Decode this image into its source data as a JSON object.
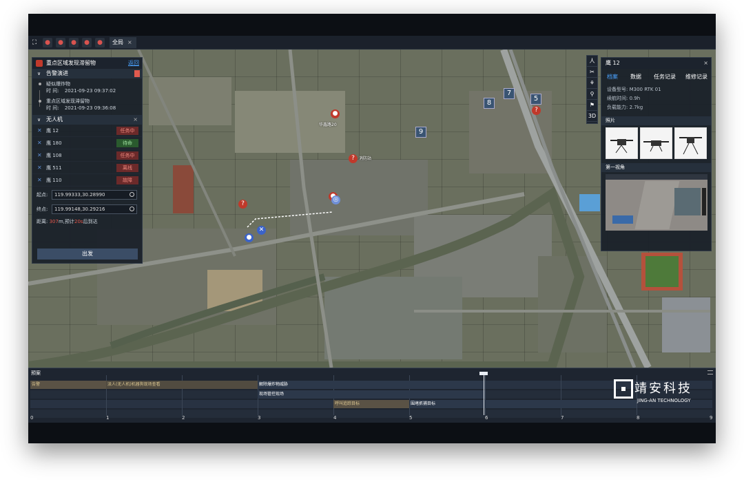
{
  "tab": {
    "label": "全局",
    "close": "×"
  },
  "left_panel": {
    "title": "重点区域发现滞留物",
    "back": "返回",
    "alert_section": "告警演进",
    "alerts": [
      {
        "name": "疑似爆炸物",
        "time_label": "时  间:",
        "time": "2021-09-23 09:37:02"
      },
      {
        "name": "重点区域发现滞留物",
        "time_label": "时  间:",
        "time": "2021-09-23 09:36:08"
      }
    ],
    "uav_section": "无人机",
    "uav_close": "×",
    "uavs": [
      {
        "name": "鹰 12",
        "status": "任务中",
        "tone": "red"
      },
      {
        "name": "鹰 180",
        "status": "待命",
        "tone": "green"
      },
      {
        "name": "鹰 108",
        "status": "任务中",
        "tone": "red"
      },
      {
        "name": "鹰 511",
        "status": "离线",
        "tone": "red"
      },
      {
        "name": "鹰 110",
        "status": "故障",
        "tone": "red"
      }
    ],
    "start_label": "起点:",
    "start_value": "119.99333,30.28990",
    "end_label": "终点:",
    "end_value": "119.99148,30.29216",
    "dist_label": "距离:",
    "dist_value": "307",
    "dist_mid": "m,预计",
    "eta_value": "20s",
    "dist_tail": "后到达",
    "go_button": "出发"
  },
  "right_panel": {
    "title": "鹰 12",
    "close": "×",
    "tabs": [
      "档案",
      "数据",
      "任务记录",
      "维修记录"
    ],
    "info": [
      "设备型号: M300 RTK 01",
      "续航时间: 0.9h",
      "负载能力: 2.7kg"
    ],
    "photos_title": "照片",
    "fpv_title": "第一视角"
  },
  "map_tools": [
    "人",
    "✂",
    "⚘",
    "⚲",
    "⚑",
    "3D"
  ],
  "map_numbers": [
    "7",
    "8",
    "5",
    "9"
  ],
  "map_labels": [
    "华鑫路20",
    "消防站"
  ],
  "timeline": {
    "title": "预案",
    "rows": [
      [
        {
          "text": "告警"
        },
        {
          "text": "派人(无人机)机器狗现场查看"
        },
        {
          "text": "解除爆炸物威胁"
        }
      ],
      [
        {
          "text": "现场管控现场"
        }
      ],
      [
        {
          "text": "呼叫追踪目标"
        },
        {
          "text": "围堵抓捕目标"
        }
      ]
    ],
    "ticks": [
      "0",
      "1",
      "2",
      "3",
      "4",
      "5",
      "6",
      "7",
      "8",
      "9"
    ]
  },
  "brand": {
    "cn": "靖安科技",
    "en": "JING-AN TECHNOLOGY"
  }
}
